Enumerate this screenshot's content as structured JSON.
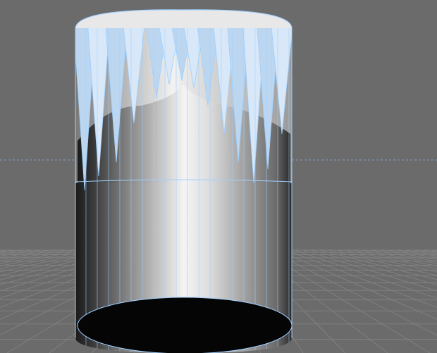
{
  "viewport": {
    "background_color": "#6b6b6b",
    "grid_color": "#808080",
    "grid_dark_color": "#595959",
    "horizon_dash_color": "#7f9fbf"
  },
  "model": {
    "object": "cylinder",
    "wireframe_color": "#9fd0ff",
    "highlight_color": "#f4f4f4",
    "shade_color": "#2a2a2a",
    "hole_color": "#050505"
  }
}
